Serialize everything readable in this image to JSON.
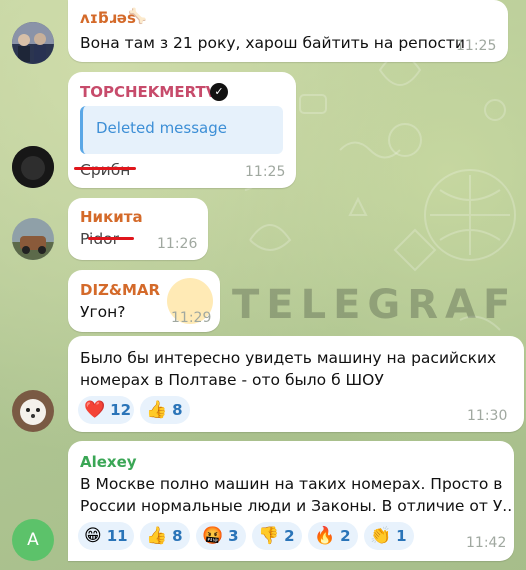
{
  "watermark": "TELEGRAF",
  "messages": [
    {
      "author": "ʌɪƃɹəs",
      "author_color": "#d46a2a",
      "text": "Вона там з 21 року, харош байтить на репости",
      "time": "11:25"
    },
    {
      "author": "TOPCHEKMERTV",
      "author_color": "#c74b6b",
      "quote": "Deleted message",
      "text": "Срибн",
      "time": "11:25"
    },
    {
      "author": "Никита",
      "author_color": "#d46a2a",
      "text": "Pidor",
      "time": "11:26"
    },
    {
      "author": "DIZ&MAR",
      "author_color": "#d46a2a",
      "text": "Угон?",
      "time": "11:29"
    },
    {
      "text_line1": "Было бы интересно увидеть машину на расийских",
      "text_line2": "номерах в Полтаве - ото было б ШОУ",
      "time": "11:30",
      "reactions": [
        {
          "icon": "red-heart",
          "emoji": "❤️",
          "count": "12"
        },
        {
          "icon": "thumbs-up",
          "emoji": "👍",
          "count": "8"
        }
      ]
    },
    {
      "author": "Alexey",
      "author_color": "#3aa655",
      "text_line1": "В Москве полно машин на таких номерах. Просто в",
      "text_line2": "России нормальные люди и Законы. В отличие от У..",
      "time": "11:42",
      "avatar_letter": "A",
      "reactions": [
        {
          "icon": "grinning-face",
          "emoji": "😁",
          "count": "11"
        },
        {
          "icon": "thumbs-up",
          "emoji": "👍",
          "count": "8"
        },
        {
          "icon": "face-with-symbols",
          "emoji": "🤬",
          "count": "3"
        },
        {
          "icon": "thumbs-down",
          "emoji": "👎",
          "count": "2"
        },
        {
          "icon": "fire",
          "emoji": "🔥",
          "count": "2"
        },
        {
          "icon": "clapping-hands",
          "emoji": "👏",
          "count": "1"
        }
      ]
    }
  ],
  "colors": {
    "reaction_bg": "#e8f2fc",
    "reaction_count": "#2a74b8",
    "strike": "#e0161c",
    "avatar_alexey": "#5cc26a"
  }
}
